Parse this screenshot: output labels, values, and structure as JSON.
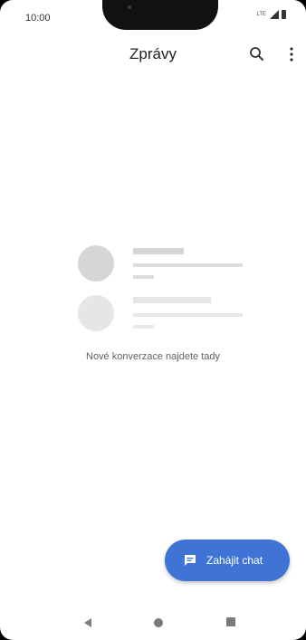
{
  "status_bar": {
    "time": "10:00",
    "network": "LTE"
  },
  "app_bar": {
    "title": "Zprávy",
    "search_icon": "search-icon",
    "more_icon": "more-vert-icon"
  },
  "empty_state": {
    "message": "Nové konverzace najdete tady"
  },
  "fab": {
    "label": "Zahájit chat",
    "icon": "chat-icon",
    "color": "#3f74d6"
  },
  "nav_bar": {
    "back_icon": "back-icon",
    "home_icon": "home-icon",
    "recents_icon": "recents-icon"
  }
}
